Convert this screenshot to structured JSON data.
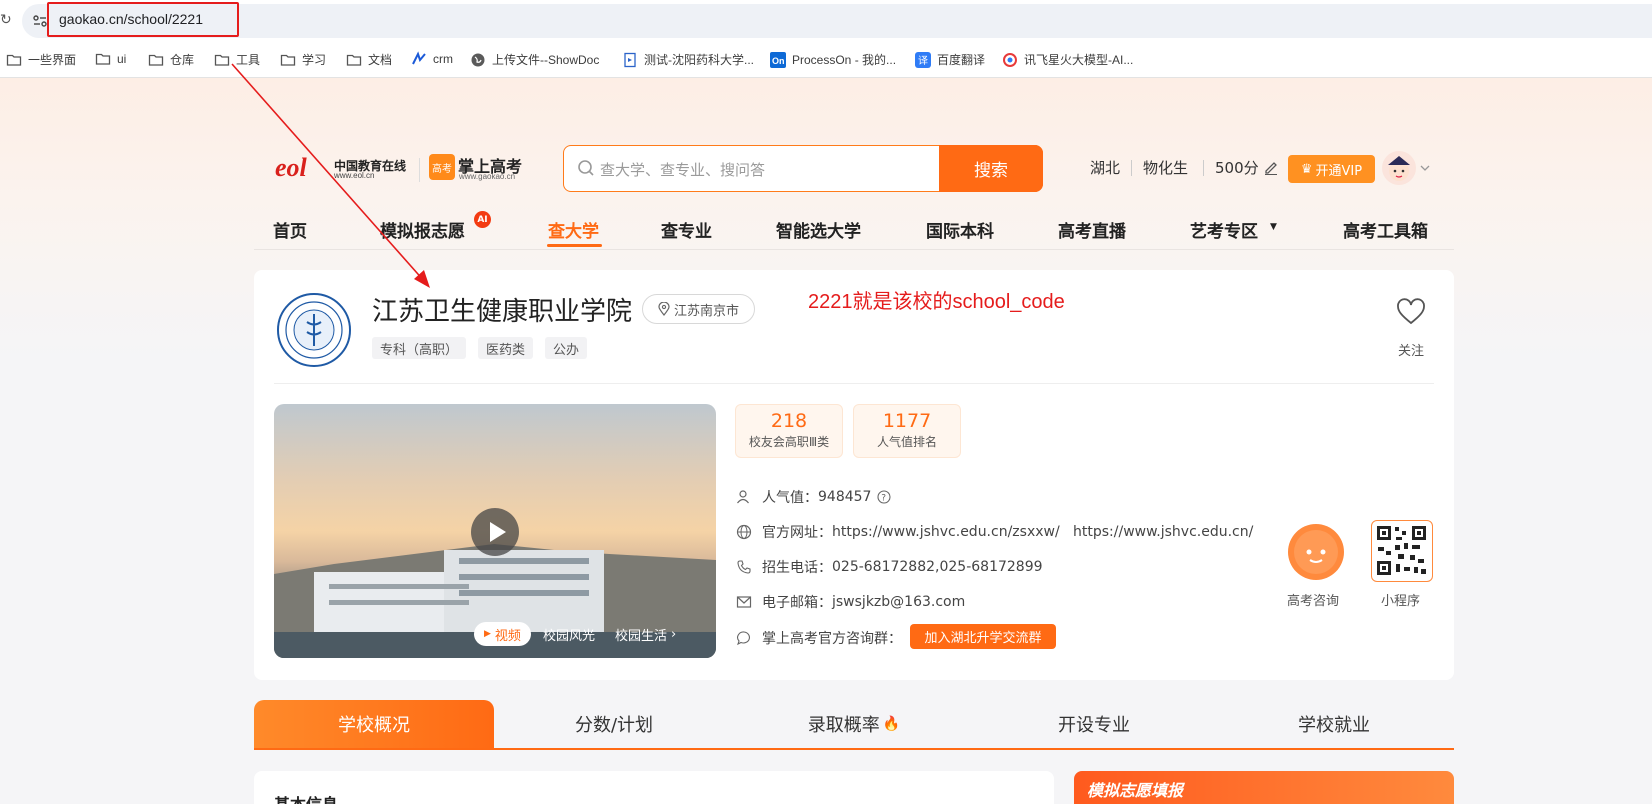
{
  "browser": {
    "url": "gaokao.cn/school/2221",
    "bookmarks": [
      {
        "label": "一些界面",
        "icon": "folder-icon"
      },
      {
        "label": "ui",
        "icon": "folder-icon"
      },
      {
        "label": "仓库",
        "icon": "folder-icon"
      },
      {
        "label": "工具",
        "icon": "folder-icon"
      },
      {
        "label": "学习",
        "icon": "folder-icon"
      },
      {
        "label": "文档",
        "icon": "folder-icon"
      },
      {
        "label": "crm",
        "icon": "crm-site-icon"
      },
      {
        "label": "上传文件--ShowDoc",
        "icon": "globe-icon"
      },
      {
        "label": "测试-沈阳药科大学...",
        "icon": "doc-site-icon"
      },
      {
        "label": "ProcessOn - 我的...",
        "icon": "processon-icon"
      },
      {
        "label": "百度翻译",
        "icon": "translate-icon"
      },
      {
        "label": "讯飞星火大模型-AI...",
        "icon": "spark-icon"
      }
    ]
  },
  "header": {
    "logo_eol_text": "中国教育在线",
    "logo_eol_sub": "www.eol.cn",
    "logo_app_text": "掌上高考",
    "logo_app_sub": "www.gaokao.cn",
    "search_placeholder": "查大学、查专业、搜问答",
    "search_button": "搜索",
    "province": "湖北",
    "subjects": "物化生",
    "score": "500分",
    "vip_label": "开通VIP"
  },
  "nav": {
    "items": [
      "首页",
      "模拟报志愿",
      "查大学",
      "查专业",
      "智能选大学",
      "国际本科",
      "高考直播",
      "艺考专区",
      "高考工具箱"
    ],
    "ai_badge": "AI",
    "active": "查大学"
  },
  "school": {
    "name": "江苏卫生健康职业学院",
    "location": "江苏南京市",
    "tags": [
      "专科（高职）",
      "医药类",
      "公办"
    ],
    "favorite_label": "关注",
    "stats": [
      {
        "value": "218",
        "label": "校友会高职Ⅲ类"
      },
      {
        "value": "1177",
        "label": "人气值排名"
      }
    ],
    "popularity_label": "人气值：",
    "popularity_value": "948457",
    "website_label": "官方网址：",
    "website_value": "https://www.jshvc.edu.cn/zsxxw/   https://www.jshvc.edu.cn/",
    "phone_label": "招生电话：",
    "phone_value": "025-68172882,025-68172899",
    "email_label": "电子邮箱：",
    "email_value": "jswsjkzb@163.com",
    "group_label": "掌上高考官方咨询群：",
    "join_group_button": "加入湖北升学交流群",
    "consult_label": "高考咨询",
    "miniprogram_label": "小程序",
    "video_tabs": [
      "视频",
      "校园风光",
      "校园生活"
    ]
  },
  "annotation_text": "2221就是该校的school_code",
  "tabs": [
    {
      "label": "学校概况",
      "active": true
    },
    {
      "label": "分数/计划",
      "active": false
    },
    {
      "label": "录取概率",
      "active": false
    },
    {
      "label": "开设专业",
      "active": false
    },
    {
      "label": "学校就业",
      "active": false
    }
  ],
  "sections": {
    "basic_info": "基本信息",
    "simulate": "模拟志愿填报"
  },
  "colors": {
    "accent": "#ff6a14",
    "annotation": "#e51c1c"
  }
}
